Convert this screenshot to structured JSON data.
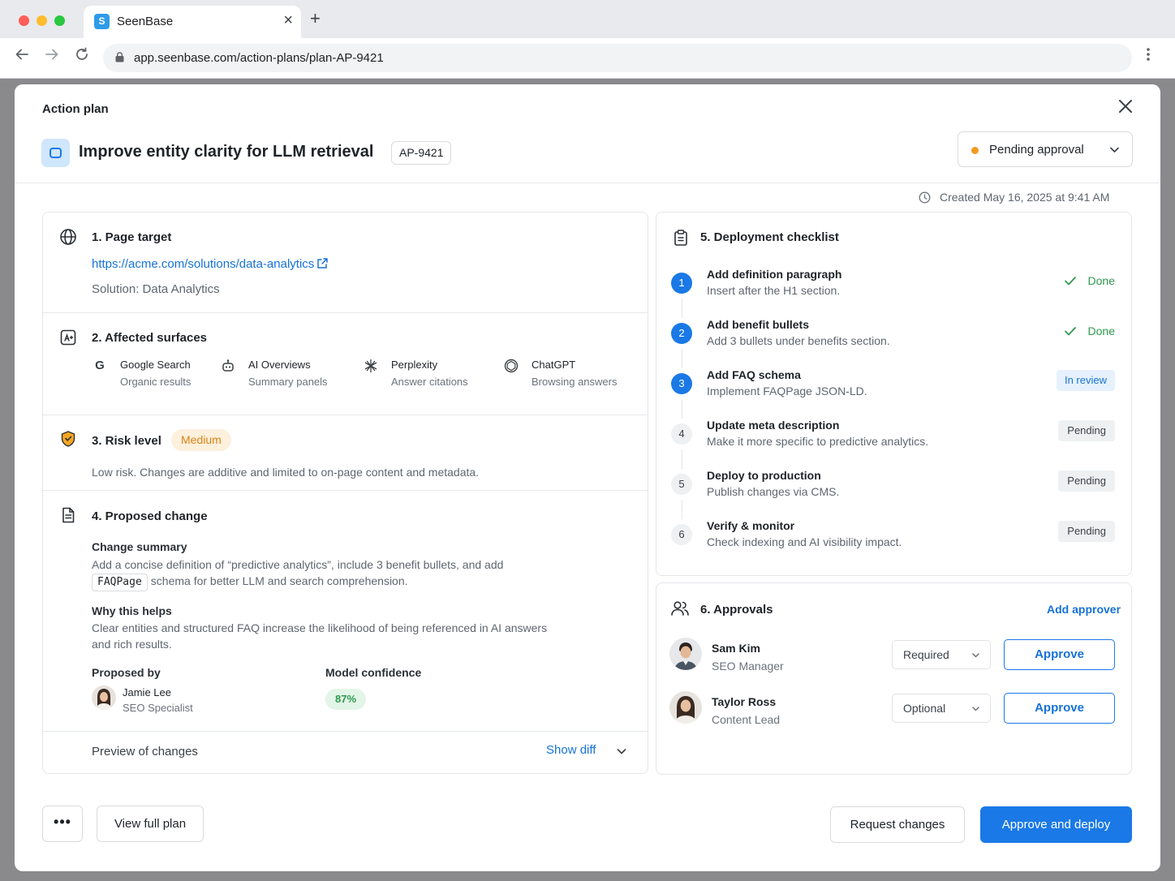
{
  "browser": {
    "tab_title": "SeenBase",
    "favicon_letter": "S",
    "url": "app.seenbase.com/action-plans/plan-AP-9421"
  },
  "modal": {
    "label": "Action plan",
    "title": "Improve entity clarity for LLM retrieval",
    "plan_id": "AP-9421",
    "status": "Pending approval",
    "created": "Created May 16, 2025 at 9:41 AM"
  },
  "page_target": {
    "title": "1. Page target",
    "url": "https://acme.com/solutions/data-analytics",
    "solution": "Solution: Data Analytics"
  },
  "surfaces": {
    "title": "2. Affected surfaces",
    "items": [
      {
        "name": "Google Search",
        "sub": "Organic results",
        "icon": "google-icon"
      },
      {
        "name": "AI Overviews",
        "sub": "Summary panels",
        "icon": "ai-overviews-icon"
      },
      {
        "name": "Perplexity",
        "sub": "Answer citations",
        "icon": "perplexity-icon"
      },
      {
        "name": "ChatGPT",
        "sub": "Browsing answers",
        "icon": "chatgpt-icon"
      }
    ]
  },
  "risk": {
    "title": "3. Risk level",
    "level": "Medium",
    "description": "Low risk. Changes are additive and limited to on-page content and metadata."
  },
  "proposed": {
    "title": "4. Proposed change",
    "summary_heading": "Change summary",
    "summary_line1": "Add a concise definition of “predictive analytics”, include 3 benefit bullets, and add",
    "summary_code": "FAQPage",
    "summary_line2": "schema for better LLM and search comprehension.",
    "why_heading": "Why this helps",
    "why_text": "Clear entities and structured FAQ increase the likelihood of being referenced in AI answers and rich results.",
    "proposed_by_label": "Proposed by",
    "proposer_name": "Jamie Lee",
    "proposer_role": "SEO Specialist",
    "confidence_label": "Model confidence",
    "confidence": "87%",
    "preview_label": "Preview of changes",
    "show_diff": "Show diff"
  },
  "checklist": {
    "title": "5. Deployment checklist",
    "steps": [
      {
        "num": "1",
        "title": "Add definition paragraph",
        "desc": "Insert after the H1 section.",
        "status": "Done"
      },
      {
        "num": "2",
        "title": "Add benefit bullets",
        "desc": "Add 3 bullets under benefits section.",
        "status": "Done"
      },
      {
        "num": "3",
        "title": "Add FAQ schema",
        "desc": "Implement FAQPage JSON-LD.",
        "status": "In review"
      },
      {
        "num": "4",
        "title": "Update meta description",
        "desc": "Make it more specific to predictive analytics.",
        "status": "Pending"
      },
      {
        "num": "5",
        "title": "Deploy to production",
        "desc": "Publish changes via CMS.",
        "status": "Pending"
      },
      {
        "num": "6",
        "title": "Verify & monitor",
        "desc": "Check indexing and AI visibility impact.",
        "status": "Pending"
      }
    ]
  },
  "approvals": {
    "title": "6. Approvals",
    "add_label": "Add approver",
    "approvers": [
      {
        "name": "Sam Kim",
        "role": "SEO Manager",
        "requirement": "Required",
        "action": "Approve"
      },
      {
        "name": "Taylor Ross",
        "role": "Content Lead",
        "requirement": "Optional",
        "action": "Approve"
      }
    ]
  },
  "footer": {
    "more_label": "•••",
    "view_full_plan": "View full plan",
    "request_changes": "Request changes",
    "approve_deploy": "Approve and deploy"
  },
  "colors": {
    "accent": "#1a79e6",
    "done": "#2e9a4d",
    "warning": "#f59a1c",
    "risk_badge_bg": "#fdf0dc"
  }
}
